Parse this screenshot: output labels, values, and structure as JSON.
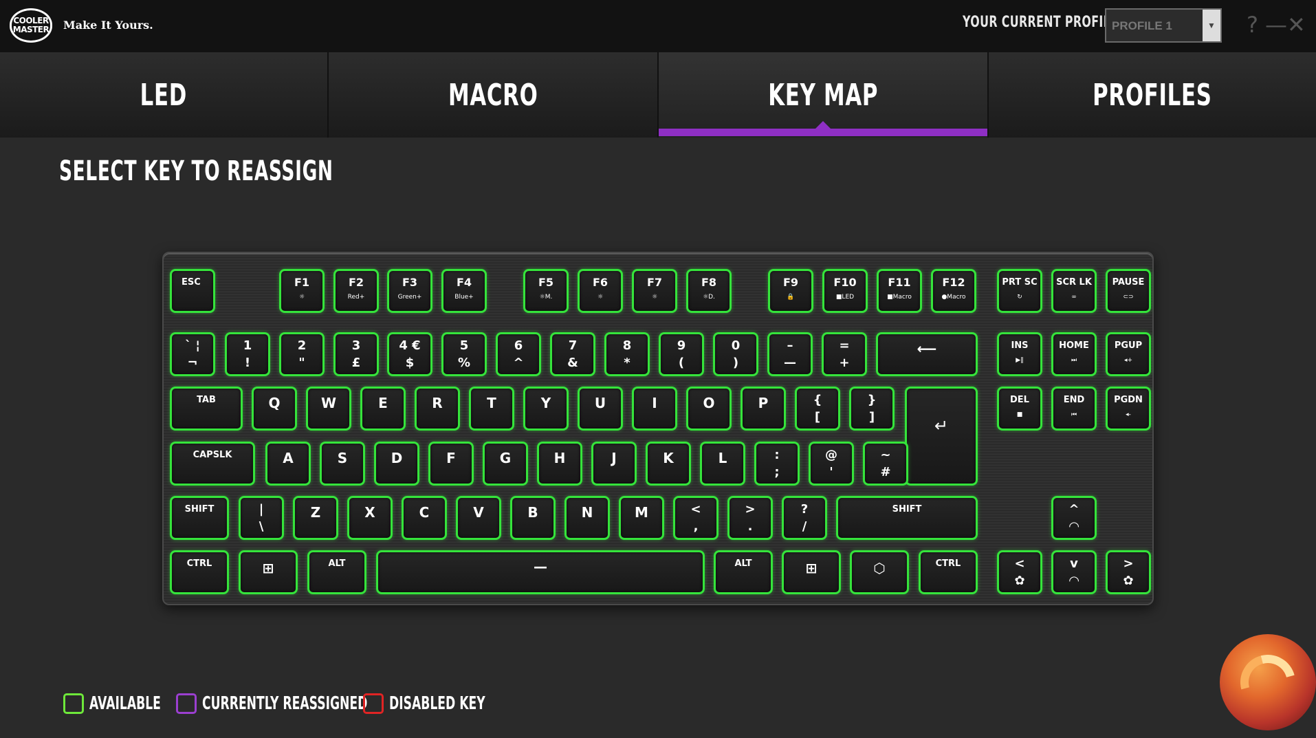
{
  "brand": {
    "logo_line1": "COOLER",
    "logo_line2": "MASTER",
    "tagline": "Make It Yours."
  },
  "profile": {
    "caption": "YOUR CURRENT PROFILE",
    "selected": "PROFILE 1"
  },
  "window_controls": {
    "help": "?",
    "minimize": "—",
    "close": "✕"
  },
  "tabs": [
    {
      "label": "LED"
    },
    {
      "label": "MACRO"
    },
    {
      "label": "KEY MAP",
      "active": true
    },
    {
      "label": "PROFILES"
    }
  ],
  "heading": "SELECT KEY TO REASSIGN",
  "keyboard": {
    "led_color": "#35e43b",
    "keys": {
      "esc": [
        "ESC",
        ""
      ],
      "f1": [
        "F1",
        "☼"
      ],
      "f2": [
        "F2",
        "Red+"
      ],
      "f3": [
        "F3",
        "Green+"
      ],
      "f4": [
        "F4",
        "Blue+"
      ],
      "f5": [
        "F5",
        "☼M."
      ],
      "f6": [
        "F6",
        "☼"
      ],
      "f7": [
        "F7",
        "☼"
      ],
      "f8": [
        "F8",
        "☼D."
      ],
      "f9": [
        "F9",
        "🔒"
      ],
      "f10": [
        "F10",
        "■LED"
      ],
      "f11": [
        "F11",
        "■Macro"
      ],
      "f12": [
        "F12",
        "●Macro"
      ],
      "prtsc": [
        "PRT SC",
        "↻"
      ],
      "scrlk": [
        "SCR LK",
        "∞"
      ],
      "pause": [
        "PAUSE",
        "⊂⊃"
      ],
      "grave": [
        "` ¦",
        "¬"
      ],
      "n1": [
        "1",
        "!"
      ],
      "n2": [
        "2",
        "\""
      ],
      "n3": [
        "3",
        "£"
      ],
      "n4": [
        "4 €",
        "$"
      ],
      "n5": [
        "5",
        "%"
      ],
      "n6": [
        "6",
        "^"
      ],
      "n7": [
        "7",
        "&"
      ],
      "n8": [
        "8",
        "*"
      ],
      "n9": [
        "9",
        "("
      ],
      "n0": [
        "0",
        ")"
      ],
      "minus": [
        "–",
        "—"
      ],
      "equal": [
        "=",
        "+"
      ],
      "backspace": [
        "⟵",
        ""
      ],
      "ins": [
        "INS",
        "▶‖"
      ],
      "home": [
        "HOME",
        "⏭"
      ],
      "pgup": [
        "PGUP",
        "◂+"
      ],
      "tab": [
        "TAB",
        ""
      ],
      "q": [
        "Q",
        ""
      ],
      "w": [
        "W",
        ""
      ],
      "e": [
        "E",
        ""
      ],
      "r": [
        "R",
        ""
      ],
      "t": [
        "T",
        ""
      ],
      "y": [
        "Y",
        ""
      ],
      "u": [
        "U",
        ""
      ],
      "i": [
        "I",
        ""
      ],
      "o": [
        "O",
        ""
      ],
      "p": [
        "P",
        ""
      ],
      "lbrace": [
        "{",
        "["
      ],
      "rbrace": [
        "}",
        "]"
      ],
      "enter": [
        "",
        "↵"
      ],
      "del": [
        "DEL",
        "■"
      ],
      "end": [
        "END",
        "⏮"
      ],
      "pgdn": [
        "PGDN",
        "◂-"
      ],
      "capslk": [
        "CAPSLK",
        ""
      ],
      "a": [
        "A",
        ""
      ],
      "s": [
        "S",
        ""
      ],
      "d": [
        "D",
        ""
      ],
      "f": [
        "F",
        ""
      ],
      "g": [
        "G",
        ""
      ],
      "h": [
        "H",
        ""
      ],
      "j": [
        "J",
        ""
      ],
      "k": [
        "K",
        ""
      ],
      "l": [
        "L",
        ""
      ],
      "semi": [
        ":",
        ";"
      ],
      "quote": [
        "@",
        "'"
      ],
      "hash": [
        "~",
        "#"
      ],
      "lshift": [
        "SHIFT",
        ""
      ],
      "bslash": [
        "|",
        "\\"
      ],
      "z": [
        "Z",
        ""
      ],
      "x": [
        "X",
        ""
      ],
      "c": [
        "C",
        ""
      ],
      "v": [
        "V",
        ""
      ],
      "b": [
        "B",
        ""
      ],
      "n": [
        "N",
        ""
      ],
      "m": [
        "M",
        ""
      ],
      "comma": [
        "<",
        ","
      ],
      "period": [
        ">",
        "."
      ],
      "slash": [
        "?",
        "/"
      ],
      "rshift": [
        "SHIFT",
        ""
      ],
      "up": [
        "^",
        "◠"
      ],
      "lctrl": [
        "CTRL",
        ""
      ],
      "lwin": [
        "⊞",
        ""
      ],
      "lalt": [
        "ALT",
        ""
      ],
      "space": [
        "—",
        ""
      ],
      "ralt": [
        "ALT",
        ""
      ],
      "rwin": [
        "⊞",
        ""
      ],
      "fn": [
        "⬡",
        ""
      ],
      "rctrl": [
        "CTRL",
        ""
      ],
      "left": [
        "<",
        "✿"
      ],
      "down": [
        "v",
        "◠"
      ],
      "right": [
        ">",
        "✿"
      ]
    }
  },
  "legend": [
    {
      "label": "AVAILABLE",
      "color": "#6ee83a"
    },
    {
      "label": "CURRENTLY REASSIGNED",
      "color": "#9b3fd0"
    },
    {
      "label": "DISABLED KEY",
      "color": "#e02424"
    }
  ]
}
